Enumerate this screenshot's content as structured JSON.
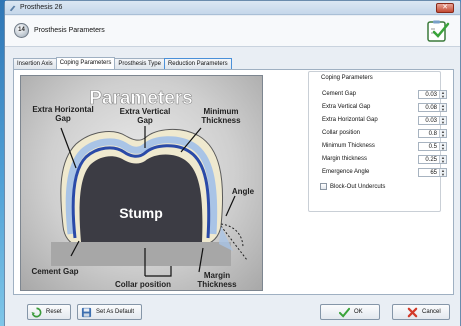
{
  "window": {
    "title": "Prosthesis 26"
  },
  "header": {
    "step": "14",
    "title": "Prosthesis Parameters"
  },
  "tabs": [
    {
      "label": "Insertion Axis",
      "active": false
    },
    {
      "label": "Coping Parameters",
      "active": true
    },
    {
      "label": "Prosthesis Type",
      "active": false
    },
    {
      "label": "Reduction Parameters",
      "active": false
    }
  ],
  "diagram": {
    "title": "Parameters",
    "labels": {
      "extra_horizontal_gap_1": "Extra Horizontal",
      "extra_horizontal_gap_2": "Gap",
      "extra_vertical_gap_1": "Extra Vertical",
      "extra_vertical_gap_2": "Gap",
      "minimum_thickness_1": "Minimum",
      "minimum_thickness_2": "Thickness",
      "angle": "Angle",
      "stump": "Stump",
      "cement_gap": "Cement Gap",
      "collar_position": "Collar position",
      "margin_thickness_1": "Margin",
      "margin_thickness_2": "Thickness"
    }
  },
  "coping": {
    "group_label": "Coping Parameters",
    "params": [
      {
        "label": "Cement Gap",
        "value": "0.03"
      },
      {
        "label": "Extra Vertical Gap",
        "value": "0.08"
      },
      {
        "label": "Extra Horizontal Gap",
        "value": "0.03"
      },
      {
        "label": "Collar position",
        "value": "0.8"
      },
      {
        "label": "Minimum Thickness",
        "value": "0.5"
      },
      {
        "label": "Margin thickness",
        "value": "0.25"
      },
      {
        "label": "Emergence Angle",
        "value": "65"
      }
    ],
    "block_out": {
      "label": "Block-Out Undercuts",
      "checked": false
    }
  },
  "footer": {
    "reset": "Reset",
    "set_default": "Set As Default",
    "ok": "OK",
    "cancel": "Cancel"
  },
  "colors": {
    "accent": "#4a90d9",
    "crown_outer": "#f2edd6",
    "coping": "#2a4aa8",
    "gap": "#a9c4e6"
  }
}
